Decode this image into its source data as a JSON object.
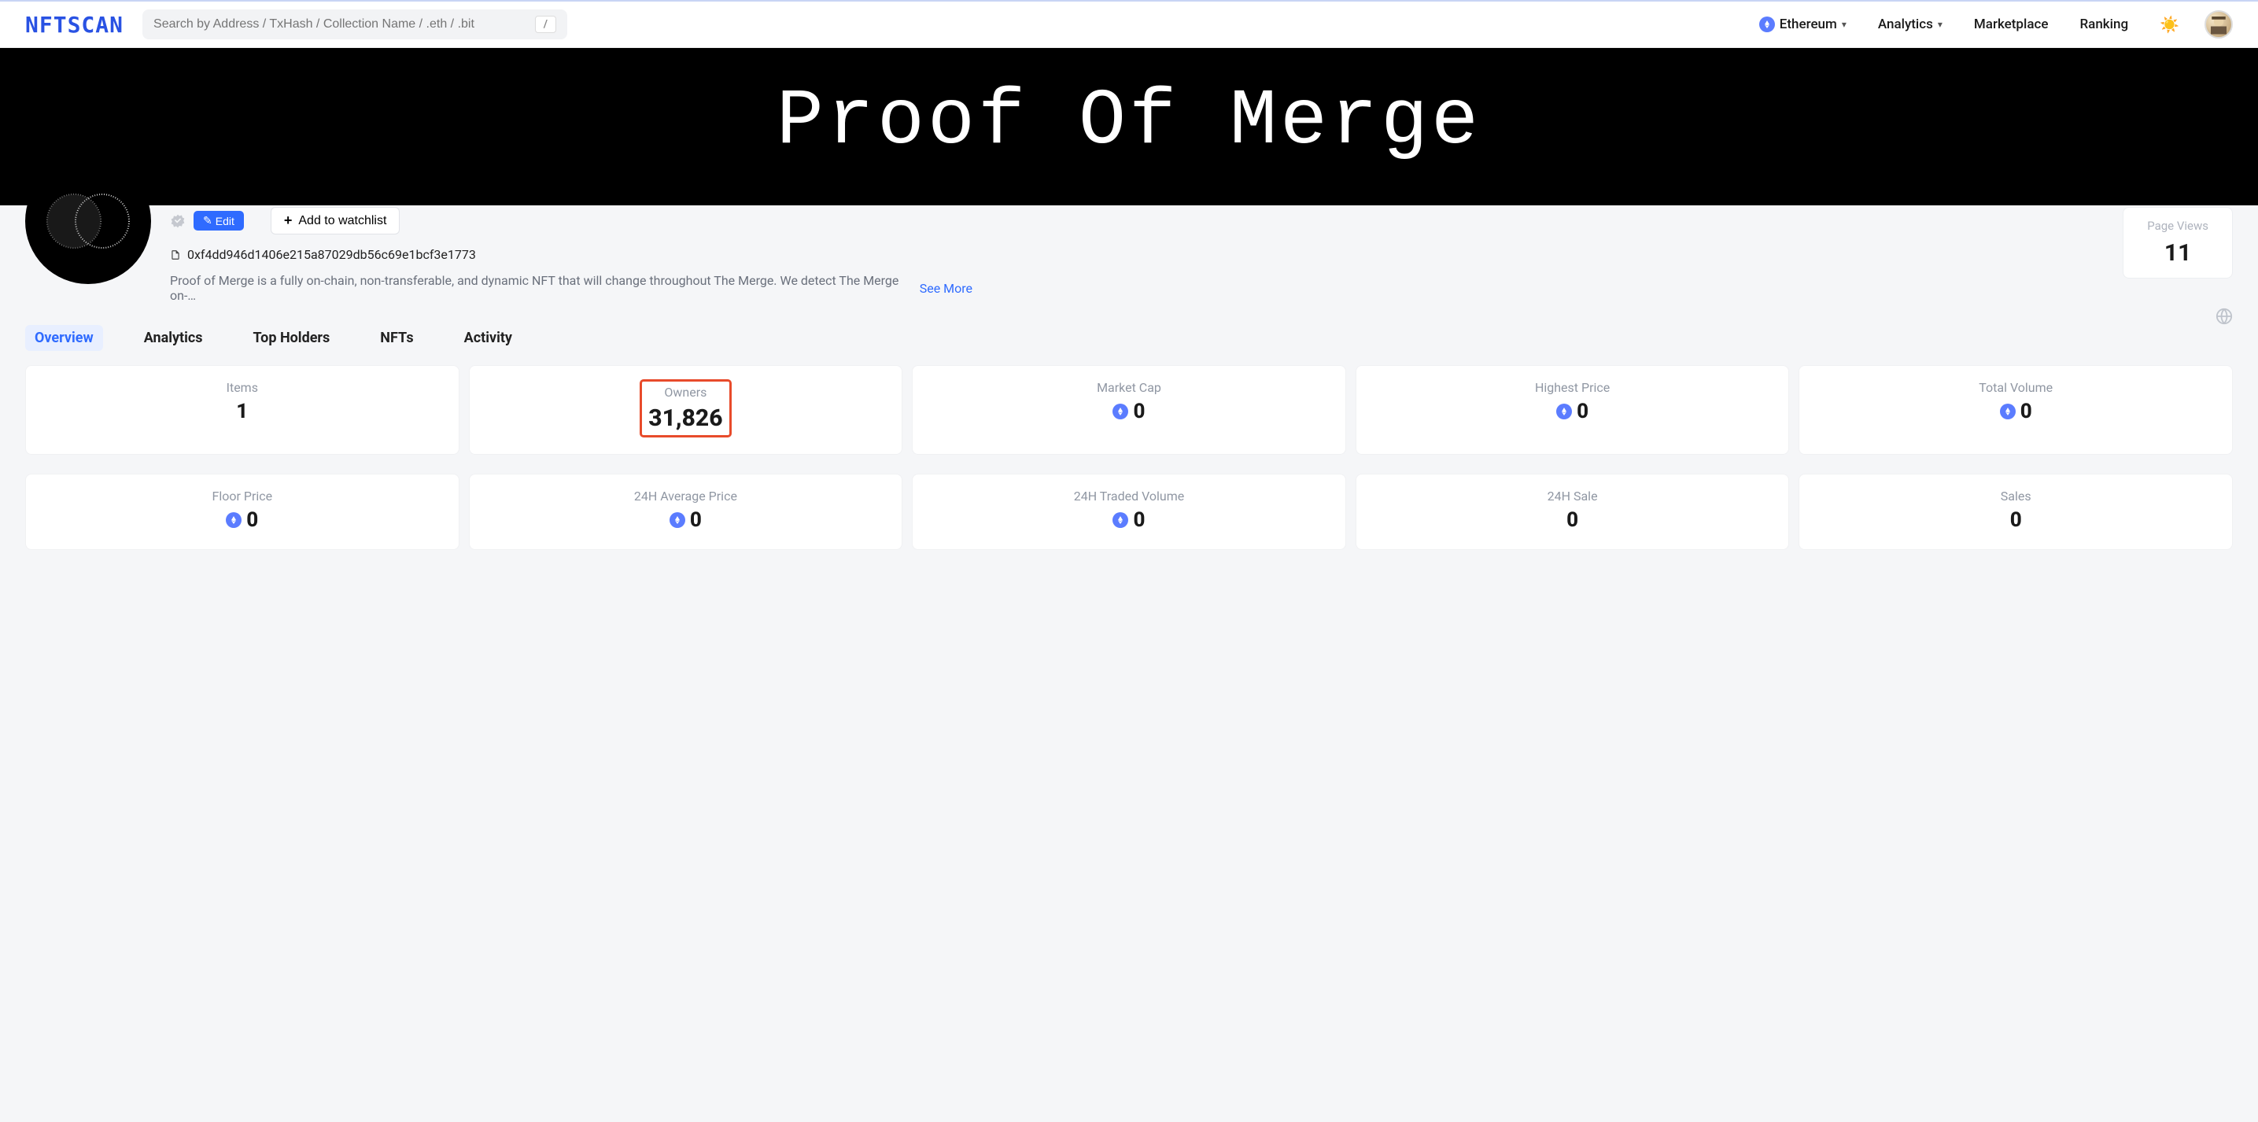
{
  "header": {
    "logo": "NFTSCAN",
    "search_placeholder": "Search by Address / TxHash / Collection Name / .eth / .bit",
    "shortcut_key": "/",
    "chain_label": "Ethereum",
    "nav": {
      "analytics": "Analytics",
      "marketplace": "Marketplace",
      "ranking": "Ranking"
    }
  },
  "banner": {
    "title": "Proof Of Merge"
  },
  "profile": {
    "edit_label": "Edit",
    "watchlist_label": "Add to watchlist",
    "address": "0xf4dd946d1406e215a87029db56c69e1bcf3e1773",
    "description": "Proof of Merge is a fully on-chain, non-transferable, and dynamic NFT that will change throughout The Merge. We detect The Merge on-…",
    "see_more": "See More",
    "pageviews_label": "Page Views",
    "pageviews_value": "11"
  },
  "tabs": [
    {
      "id": "overview",
      "label": "Overview",
      "active": true
    },
    {
      "id": "analytics",
      "label": "Analytics",
      "active": false
    },
    {
      "id": "top-holders",
      "label": "Top Holders",
      "active": false
    },
    {
      "id": "nfts",
      "label": "NFTs",
      "active": false
    },
    {
      "id": "activity",
      "label": "Activity",
      "active": false
    }
  ],
  "stats": {
    "row1": [
      {
        "label": "Items",
        "value": "1",
        "icon": null,
        "highlight": false
      },
      {
        "label": "Owners",
        "value": "31,826",
        "icon": null,
        "highlight": true
      },
      {
        "label": "Market Cap",
        "value": "0",
        "icon": "eth",
        "highlight": false
      },
      {
        "label": "Highest Price",
        "value": "0",
        "icon": "eth",
        "highlight": false
      },
      {
        "label": "Total Volume",
        "value": "0",
        "icon": "eth",
        "highlight": false
      }
    ],
    "row2": [
      {
        "label": "Floor Price",
        "value": "0",
        "icon": "eth",
        "highlight": false
      },
      {
        "label": "24H Average Price",
        "value": "0",
        "icon": "eth",
        "highlight": false
      },
      {
        "label": "24H Traded Volume",
        "value": "0",
        "icon": "eth",
        "highlight": false
      },
      {
        "label": "24H Sale",
        "value": "0",
        "icon": null,
        "highlight": false
      },
      {
        "label": "Sales",
        "value": "0",
        "icon": null,
        "highlight": false
      }
    ]
  }
}
